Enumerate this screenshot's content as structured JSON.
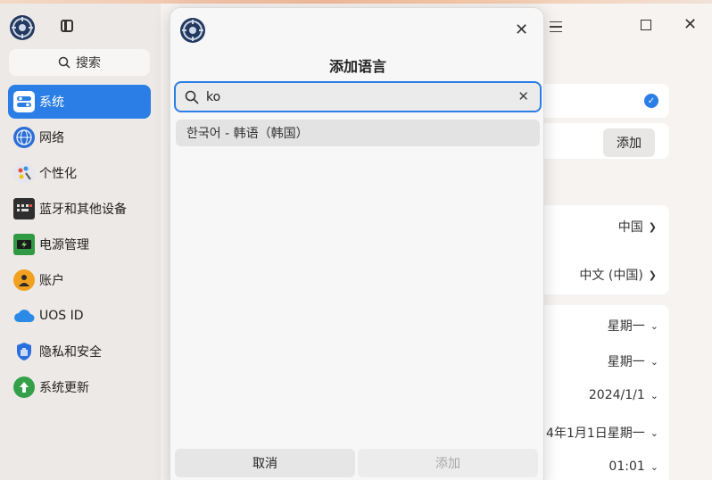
{
  "sidebar": {
    "search_label": "搜索",
    "items": [
      {
        "label": "系统",
        "icon": "system-toggle-icon",
        "color": "#ffffff",
        "active": true
      },
      {
        "label": "网络",
        "icon": "globe-icon",
        "color": "#2b6fd6"
      },
      {
        "label": "个性化",
        "icon": "palette-icon",
        "color": "#e9e9f0"
      },
      {
        "label": "蓝牙和其他设备",
        "icon": "keyboard-icon",
        "color": "#333333"
      },
      {
        "label": "电源管理",
        "icon": "battery-icon",
        "color": "#2f9a43"
      },
      {
        "label": "账户",
        "icon": "user-icon",
        "color": "#f2a020"
      },
      {
        "label": "UOS ID",
        "icon": "cloud-icon",
        "color": "#2b8ae6"
      },
      {
        "label": "隐私和安全",
        "icon": "shield-icon",
        "color": "#2a6fe0"
      },
      {
        "label": "系统更新",
        "icon": "update-gear-icon",
        "color": "#35a04a"
      }
    ]
  },
  "background": {
    "add_button": "添加",
    "region_value": "中国",
    "language_value": "中文 (中国)",
    "first_day_value": "星期一",
    "short_week_value": "星期一",
    "short_date_value": "2024/1/1",
    "long_date_value": "4年1月1日星期一",
    "time_value": "01:01"
  },
  "dialog": {
    "title": "添加语言",
    "search_value": "ko",
    "results": [
      "한국어 - 韩语（韩国）"
    ],
    "cancel_label": "取消",
    "add_label": "添加"
  },
  "colors": {
    "accent": "#2a7ee6"
  }
}
